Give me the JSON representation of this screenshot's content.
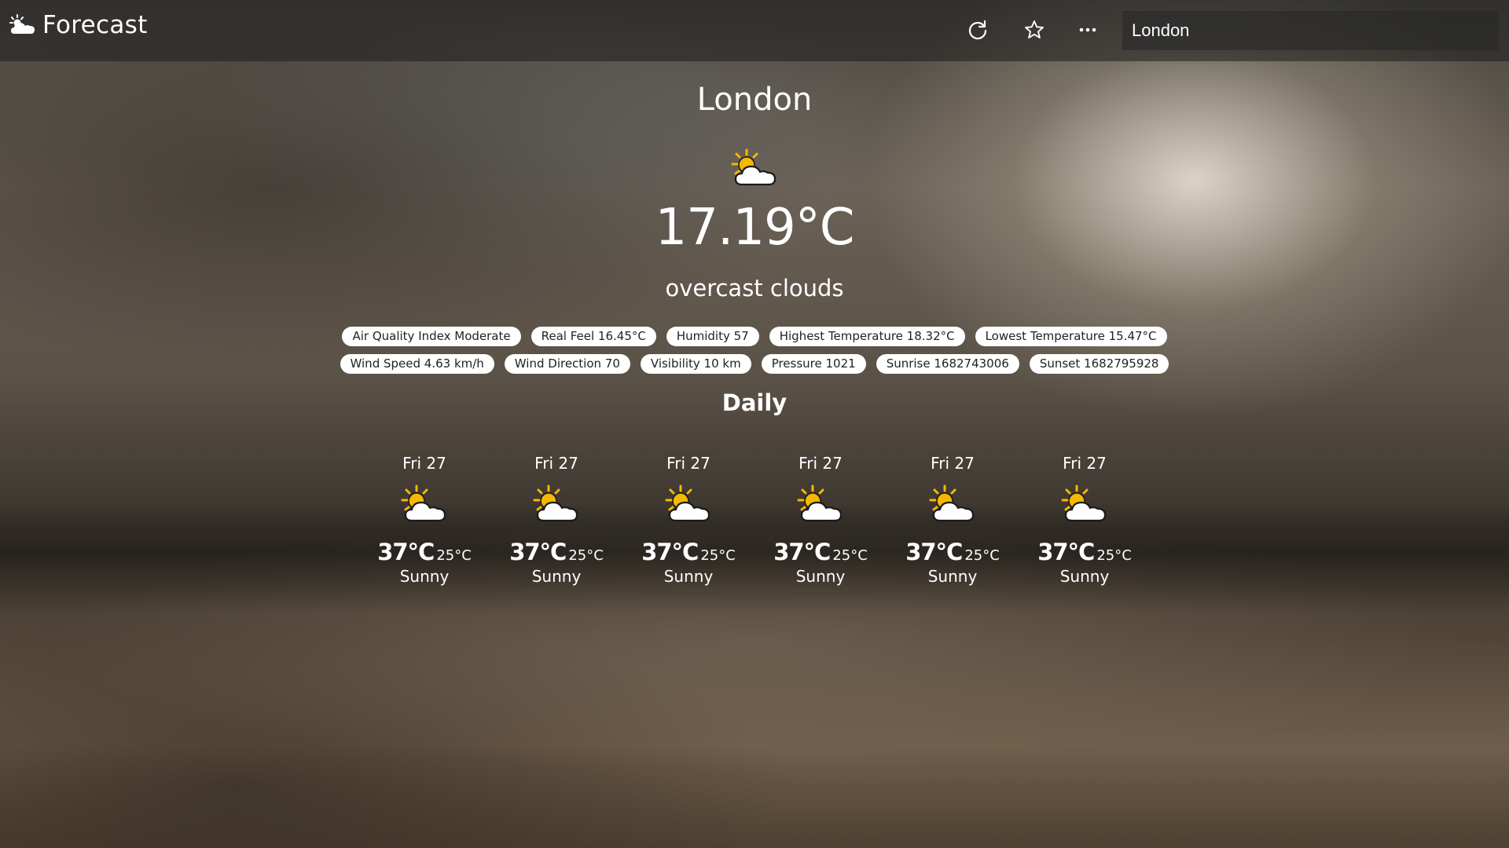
{
  "app": {
    "title": "Forecast"
  },
  "search": {
    "value": "London"
  },
  "current": {
    "city": "London",
    "temperature": "17.19°C",
    "description": "overcast clouds",
    "icon": "partly-cloudy-icon"
  },
  "details": [
    "Air Quality Index Moderate",
    "Real Feel 16.45°C",
    "Humidity 57",
    "Highest Temperature 18.32°C",
    "Lowest Temperature 15.47°C",
    "Wind Speed 4.63 km/h",
    "Wind Direction 70",
    "Visibility 10 km",
    "Pressure 1021",
    "Sunrise 1682743006",
    "Sunset 1682795928"
  ],
  "daily": {
    "title": "Daily",
    "days": [
      {
        "label": "Fri 27",
        "high": "37°C",
        "low": "25°C",
        "condition": "Sunny",
        "icon": "partly-cloudy-icon"
      },
      {
        "label": "Fri 27",
        "high": "37°C",
        "low": "25°C",
        "condition": "Sunny",
        "icon": "partly-cloudy-icon"
      },
      {
        "label": "Fri 27",
        "high": "37°C",
        "low": "25°C",
        "condition": "Sunny",
        "icon": "partly-cloudy-icon"
      },
      {
        "label": "Fri 27",
        "high": "37°C",
        "low": "25°C",
        "condition": "Sunny",
        "icon": "partly-cloudy-icon"
      },
      {
        "label": "Fri 27",
        "high": "37°C",
        "low": "25°C",
        "condition": "Sunny",
        "icon": "partly-cloudy-icon"
      },
      {
        "label": "Fri 27",
        "high": "37°C",
        "low": "25°C",
        "condition": "Sunny",
        "icon": "partly-cloudy-icon"
      }
    ]
  },
  "toolbar_icons": [
    "refresh-icon",
    "star-icon",
    "more-icon"
  ],
  "colors": {
    "badge_bg": "#ffffff",
    "badge_text": "#222222",
    "sun": "#f5b800",
    "cloud": "#ffffff"
  }
}
